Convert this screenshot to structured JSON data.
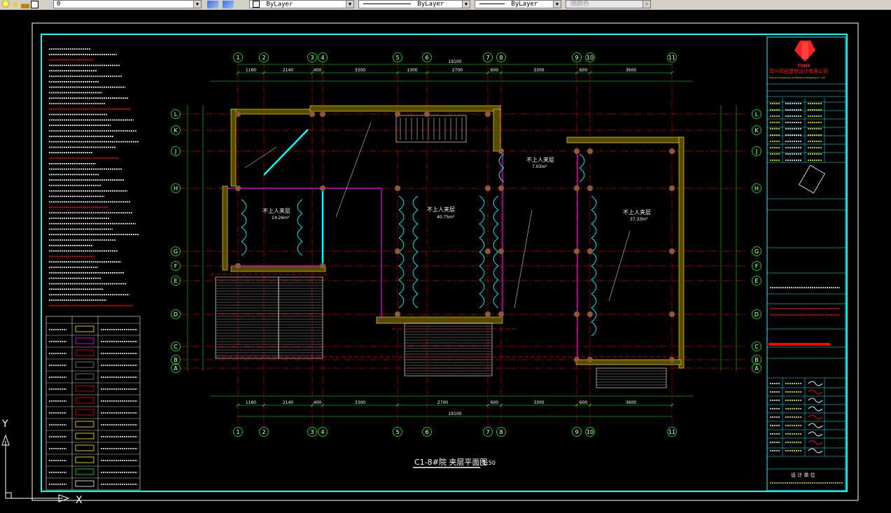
{
  "toolbar": {
    "layer_value": "0",
    "color_value": "ByLayer",
    "linetype_value": "ByLayer",
    "lineweight_value": "ByLayer",
    "plotstyle_value": "随颜色"
  },
  "drawing": {
    "title": "C1-8#院 夹层平面图",
    "scale": "1:50",
    "column_axes": [
      "1",
      "2",
      "3",
      "4",
      "5",
      "6",
      "7",
      "8",
      "9",
      "10",
      "11"
    ],
    "row_axes": [
      "L",
      "K",
      "J",
      "H",
      "G",
      "F",
      "E",
      "D",
      "C",
      "B",
      "A"
    ],
    "top_dims": [
      "1160",
      "2140",
      "400",
      "3300",
      "1300",
      "2700",
      "600",
      "3300",
      "600",
      "3600"
    ],
    "top_total": "19100",
    "bottom_dims": [
      "1160",
      "2140",
      "400",
      "3300",
      "2700",
      "600",
      "3300",
      "600",
      "3600"
    ],
    "bottom_total": "19100",
    "rooms": [
      {
        "name": "不上人夹层",
        "area": "14.26m²"
      },
      {
        "name": "不上人夹层",
        "area": "40.75m²"
      },
      {
        "name": "不上人夹层",
        "area": "7.03m²"
      },
      {
        "name": "不上人夹层",
        "area": "37.33m²"
      }
    ]
  },
  "titleblock": {
    "brand": "TONY",
    "company": "四川同创建筑设计有限公司",
    "company_en": "Sichuan Tongchuang Architectural Designing Co., Ltd.",
    "footer": "设 计 单 位"
  },
  "ucs": {
    "y": "Y",
    "x": "X"
  },
  "colors": {
    "cyan": "#00ffff",
    "red": "#ff0000",
    "green": "#00ff00",
    "yellow": "#ffff00",
    "magenta": "#ff00ff",
    "white": "#ffffff",
    "grid_red": "#c00000"
  }
}
